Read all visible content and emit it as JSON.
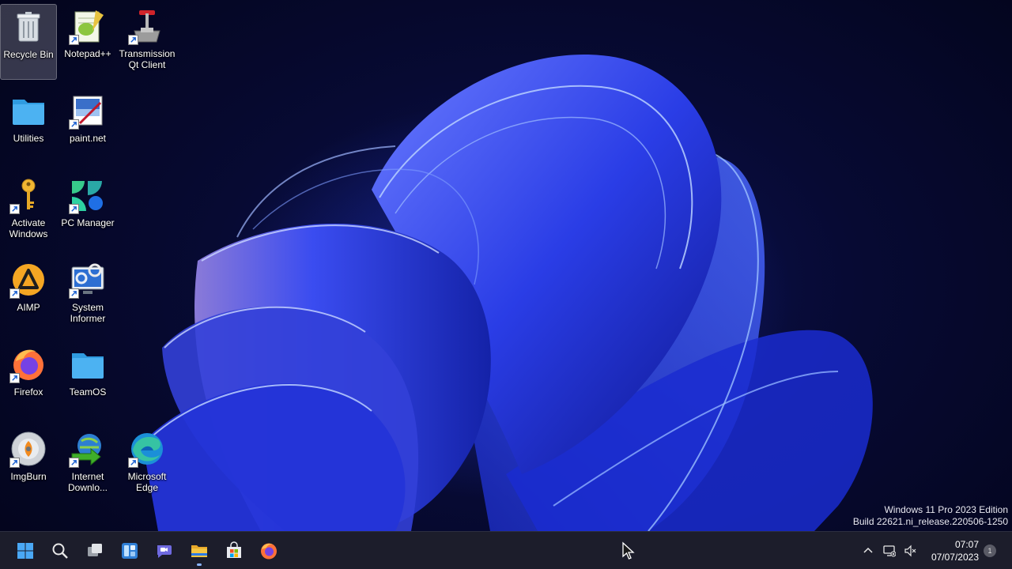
{
  "desktop": {
    "icons": [
      {
        "label": "Recycle Bin",
        "icon": "recycle-bin-icon",
        "shortcut": false
      },
      {
        "label": "Notepad++",
        "icon": "notepad-plus-plus-icon",
        "shortcut": true
      },
      {
        "label": "Transmission\nQt Client",
        "icon": "transmission-icon",
        "shortcut": true
      },
      {
        "label": "Utilities",
        "icon": "folder-icon",
        "shortcut": false
      },
      {
        "label": "paint.net",
        "icon": "paint-net-icon",
        "shortcut": true
      },
      {
        "label": "Activate\nWindows",
        "icon": "key-icon",
        "shortcut": true
      },
      {
        "label": "PC Manager",
        "icon": "pc-manager-icon",
        "shortcut": true
      },
      {
        "label": "AIMP",
        "icon": "aimp-icon",
        "shortcut": true
      },
      {
        "label": "System\nInformer",
        "icon": "system-informer-icon",
        "shortcut": true
      },
      {
        "label": "Firefox",
        "icon": "firefox-icon",
        "shortcut": true
      },
      {
        "label": "TeamOS",
        "icon": "folder-icon",
        "shortcut": false
      },
      {
        "label": "ImgBurn",
        "icon": "imgburn-icon",
        "shortcut": true
      },
      {
        "label": "Internet\nDownlo...",
        "icon": "internet-download-manager-icon",
        "shortcut": true
      },
      {
        "label": "Microsoft\nEdge",
        "icon": "edge-icon",
        "shortcut": true
      }
    ],
    "watermark": {
      "line1": "Windows 11 Pro 2023 Edition",
      "line2": "Build 22621.ni_release.220506-1250"
    }
  },
  "taskbar": {
    "apps": [
      {
        "name": "start-button",
        "icon": "windows-logo-icon"
      },
      {
        "name": "search-button",
        "icon": "search-icon"
      },
      {
        "name": "task-view-button",
        "icon": "task-view-icon"
      },
      {
        "name": "widgets-button",
        "icon": "widgets-icon"
      },
      {
        "name": "teams-chat-button",
        "icon": "teams-chat-icon"
      },
      {
        "name": "file-explorer-button",
        "icon": "file-explorer-icon"
      },
      {
        "name": "microsoft-store-button",
        "icon": "store-icon"
      },
      {
        "name": "firefox-taskbar-button",
        "icon": "firefox-icon"
      }
    ],
    "tray": {
      "time": "07:07",
      "date": "07/07/2023",
      "notification_count": "1"
    }
  },
  "colors": {
    "accent": "#3b82f6",
    "taskbar_bg": "#1c1d2b",
    "folder": "#4cb2f2"
  }
}
